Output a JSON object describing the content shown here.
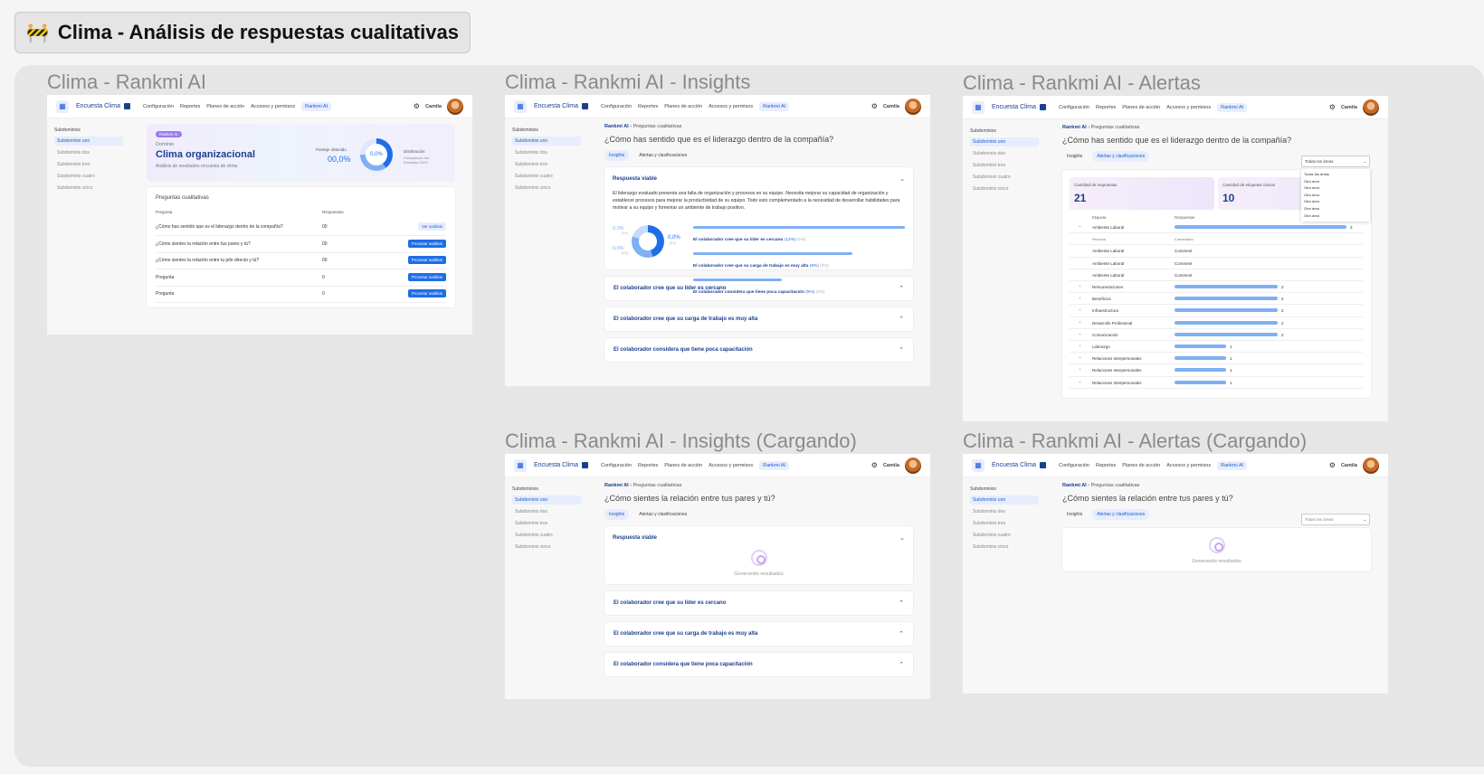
{
  "page": {
    "emoji": "🚧",
    "title": "Clima - Análisis de respuestas cualitativas"
  },
  "nav": {
    "app_title": "Encuesta Clima",
    "menu": [
      "Configuración",
      "Reportes",
      "Planes de acción",
      "Accesos y permisos",
      "Rankmi AI"
    ],
    "user": "Camila"
  },
  "sidebar": {
    "heading": "Subdominios",
    "items": [
      "Subdominio uno",
      "Subdominio dos",
      "Subdominio tres",
      "Subdominio cuatro",
      "Subdominio cinco"
    ]
  },
  "frames": {
    "f1": {
      "title": "Clima - Rankmi AI"
    },
    "f2": {
      "title": "Clima - Rankmi AI - Insights"
    },
    "f3": {
      "title": "Clima - Rankmi AI - Alertas"
    },
    "f4": {
      "title": "Clima - Rankmi AI - Insights (Cargando)"
    },
    "f5": {
      "title": "Clima - Rankmi AI - Alertas (Cargando)"
    }
  },
  "overview": {
    "badge": "Rankmi AI",
    "domain_label": "Dominio",
    "domain_title": "Clima organizacional",
    "domain_sub": "Análisis de resultados encuesta de clima",
    "score_label": "Puntaje obtenido",
    "score_value": "00,0%",
    "donut_value": "0,0%",
    "dist_label": "Distribución",
    "dist_sub": "Comparado con Encuesta 2022",
    "table_title": "Preguntas cualitativas",
    "col_question": "Pregunta",
    "col_answers": "Respuestas",
    "rows": [
      {
        "q": "¿Cómo has sentido que es el liderazgo dentro de la compañía?",
        "n": "00",
        "action": "Ver análisis"
      },
      {
        "q": "¿Cómo sientes la relación entre tus pares y tú?",
        "n": "00",
        "action": "Procesar análisis"
      },
      {
        "q": "¿Cómo sientes la relación entre tu jefe directo y tú?",
        "n": "00",
        "action": "Procesar análisis"
      },
      {
        "q": "Pregunta",
        "n": "0",
        "action": "Procesar análisis"
      },
      {
        "q": "Pregunta",
        "n": "0",
        "action": "Procesar análisis"
      }
    ]
  },
  "common": {
    "crumb_root": "Rankmi AI",
    "crumb_sep": "›",
    "crumb_leaf": "Preguntas cualitativas",
    "q_leadership": "¿Cómo has sentido que es el liderazgo dentro de la compañía?",
    "q_peers": "¿Cómo sientes la relación entre tus pares y tú?",
    "tab_insights": "Insights",
    "tab_alerts": "Alertas y clasificaciones",
    "acc_viable": "Respuesta viable",
    "acc_items": [
      "El colaborador cree que su líder es cercano",
      "El colaborador cree que su carga de trabajo es muy alta",
      "El colaborador considera que tiene poca capacitación"
    ],
    "generating": "Generando resultados",
    "filter": "Todas las áreas"
  },
  "insights": {
    "paragraph": "El liderazgo evaluado presenta una falta de organización y procesos en su equipo. Necesita mejorar su capacidad de organización y establecer procesos para mejorar la productividad de su equipo. Todo esto complementado a la necesidad de desarrollar habilidades para motivar a su equipo y fomentar un ambiente de trabajo positivo.",
    "pct_left_1": "0,0%",
    "pct_left_1_sub": "(XX)",
    "pct_left_2": "0,0%",
    "pct_left_2_sub": "(XX)",
    "pct_right": "0,0%",
    "pct_right_sub": "(XX)",
    "legend": [
      {
        "label": "El colaborador cree que su líder es cercano",
        "pct": "(12%)",
        "n": "(XX)",
        "value": 0.12
      },
      {
        "label": "El colaborador cree que su carga de trabajo es muy alta",
        "pct": "(9%)",
        "n": "(XX)",
        "value": 0.09
      },
      {
        "label": "El colaborador considera que tiene poca capacitación",
        "pct": "(5%)",
        "n": "(XX)",
        "value": 0.05
      }
    ]
  },
  "alerts": {
    "count_label": "Cantidad de respuestas",
    "count_value": "21",
    "tags_label": "Cantidad de etiquetas únicas",
    "tags_value": "10",
    "col_tag": "Etiqueta",
    "col_resp": "Respuestas",
    "expanded": {
      "tag": "Ambiente Laboral",
      "n": "3"
    },
    "sub_cols": [
      "Persona",
      "Comentario"
    ],
    "sub_rows": [
      {
        "p": "Ambiente Laboral",
        "c": "Comment"
      },
      {
        "p": "Ambiente Laboral",
        "c": "Comment"
      },
      {
        "p": "Ambiente Laboral",
        "c": "Comment"
      }
    ],
    "rows": [
      {
        "tag": "Remuneraciones",
        "n": "2"
      },
      {
        "tag": "Beneficios",
        "n": "2"
      },
      {
        "tag": "Infraestructura",
        "n": "2"
      },
      {
        "tag": "Desarrollo Profesional",
        "n": "2"
      },
      {
        "tag": "Comunicación",
        "n": "2"
      },
      {
        "tag": "Liderazgo",
        "n": "1"
      },
      {
        "tag": "Relaciones Interpersonales",
        "n": "1"
      },
      {
        "tag": "Relaciones Interpersonales",
        "n": "1"
      },
      {
        "tag": "Relaciones Interpersonales",
        "n": "1"
      }
    ],
    "dropdown": [
      "Todas las áreas",
      "Otra área",
      "Otra área",
      "Otra área",
      "Otra área",
      "Otra área",
      "Otra área"
    ]
  }
}
